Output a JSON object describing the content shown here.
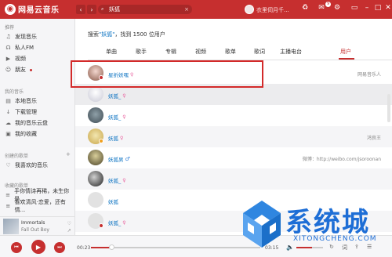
{
  "app": {
    "title": "网易云音乐",
    "accent": "#c62f2f"
  },
  "topbar": {
    "back": "‹",
    "forward": "›",
    "search_value": "妖狐",
    "search_clear": "×",
    "user_name": "衣里伺月千...",
    "icons": [
      "skin-icon",
      "mail-icon",
      "settings-icon",
      "minimize-icon",
      "maximize-icon",
      "close-icon"
    ],
    "mail_badge": "9"
  },
  "sidebar": {
    "section_recommend": "推荐",
    "recommend": [
      "发现音乐",
      "私人FM",
      "视频",
      "朋友"
    ],
    "section_mine": "我的音乐",
    "mine": [
      "本地音乐",
      "下载管理",
      "我的音乐云盘",
      "我的收藏"
    ],
    "section_created": "创建的歌单",
    "created": [
      "我喜欢的音乐"
    ],
    "section_collected": "收藏的歌单",
    "collected": [
      "手你情诗再稀，未生你是...",
      "喜欢清风·恋爱，还有情..."
    ]
  },
  "now_playing": {
    "title": "Immortals",
    "artist": "Fall Out Boy"
  },
  "search": {
    "prefix": "搜索",
    "keyword": "\"妖狐\"",
    "suffix": "，找到 1500 位用户",
    "tabs": [
      "单曲",
      "歌手",
      "专辑",
      "视频",
      "歌单",
      "歌词",
      "主播电台",
      "用户"
    ],
    "active_tab": "用户"
  },
  "users": [
    {
      "name": "星折妖嘿",
      "gender": "female",
      "desc": "网易音乐人"
    },
    {
      "name": "妖狐_",
      "gender": "female",
      "desc": ""
    },
    {
      "name": "妖狐_",
      "gender": "female",
      "desc": ""
    },
    {
      "name": "妖狐",
      "gender": "female",
      "desc": "鸿良王"
    },
    {
      "name": "妖狐男",
      "gender": "male",
      "desc": "微博：http://weibo.com/jsoroonan"
    },
    {
      "name": "妖狐_",
      "gender": "female",
      "desc": ""
    },
    {
      "name": "妖狐",
      "gender": "",
      "desc": ""
    },
    {
      "name": "妖狐_",
      "gender": "female",
      "desc": ""
    }
  ],
  "player": {
    "current_time": "00:23",
    "total_time": "03:15",
    "progress": 0.12,
    "volume": 0.6
  },
  "watermark": {
    "text": "系统城",
    "sub": "XITONGCHENG.COM"
  }
}
